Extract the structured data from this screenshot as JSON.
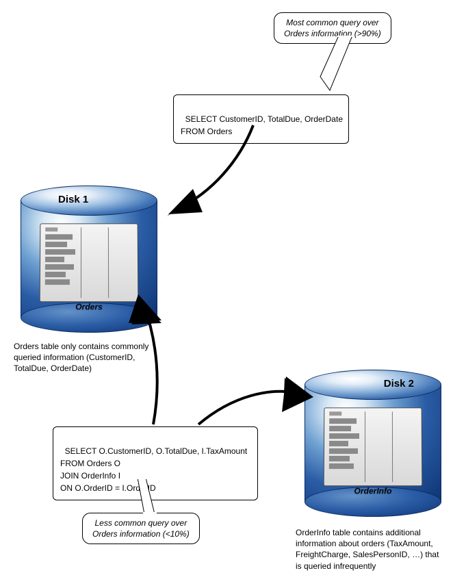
{
  "callouts": {
    "top": "Most common query over\nOrders information (>90%)",
    "bottom": "Less common query over\nOrders information (<10%)"
  },
  "queries": {
    "q1": "SELECT CustomerID, TotalDue, OrderDate\nFROM Orders",
    "q2": "SELECT O.CustomerID, O.TotalDue, I.TaxAmount\nFROM Orders O\nJOIN OrderInfo I\nON O.OrderID = I.OrderID"
  },
  "disks": {
    "d1": {
      "label": "Disk 1",
      "table": "Orders"
    },
    "d2": {
      "label": "Disk 2",
      "table": "OrderInfo"
    }
  },
  "captions": {
    "c1": "Orders table only contains commonly\nqueried information (CustomerID,\nTotalDue, OrderDate)",
    "c2": "OrderInfo table contains additional\ninformation about orders (TaxAmount,\nFreightCharge, SalesPersonID, …) that\nis queried infrequently"
  }
}
